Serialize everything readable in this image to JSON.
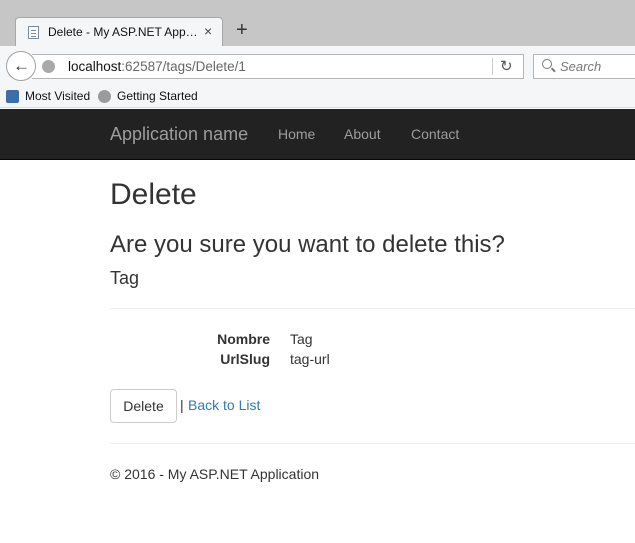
{
  "browser": {
    "tab_title": "Delete - My ASP.NET Application",
    "tab_close": "×",
    "new_tab": "+",
    "back": "←",
    "url_host": "localhost",
    "url_rest": ":62587/tags/Delete/1",
    "reload": "↻",
    "search_placeholder": "Search",
    "bookmarks": [
      "Most Visited",
      "Getting Started"
    ]
  },
  "site": {
    "brand": "Application name",
    "nav": [
      "Home",
      "About",
      "Contact"
    ]
  },
  "page": {
    "title": "Delete",
    "question": "Are you sure you want to delete this?",
    "entity": "Tag",
    "fields": [
      {
        "label": "Nombre",
        "value": "Tag"
      },
      {
        "label": "UrlSlug",
        "value": "tag-url"
      }
    ],
    "delete_button": "Delete",
    "separator": "|",
    "back_link": "Back to List",
    "footer": "© 2016 - My ASP.NET Application"
  }
}
